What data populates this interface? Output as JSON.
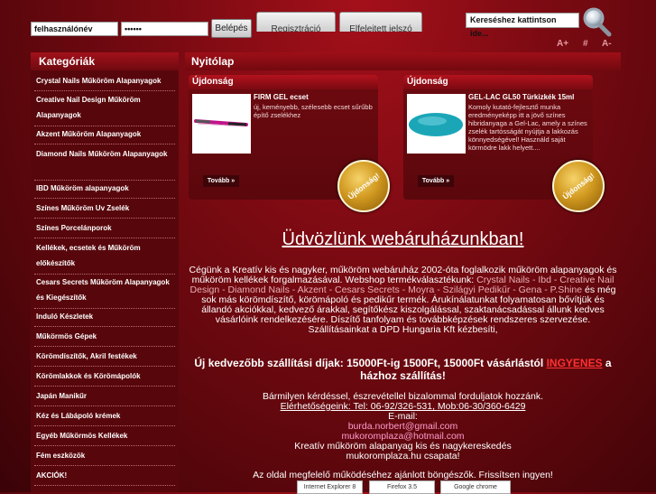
{
  "login": {
    "username_value": "felhasználónév",
    "password_value": "••••••",
    "login_label": "Belépés"
  },
  "tabs": {
    "register_label": "Regisztráció",
    "forgot_label": "Elfelejtett jelszó"
  },
  "search": {
    "value": "Kereséshez kattintson ide..."
  },
  "font_tools": {
    "increase": "A+",
    "reset": "#",
    "decrease": "A-"
  },
  "sidebar": {
    "title": "Kategóriák",
    "items": [
      {
        "label": "Crystal Nails Műköröm Alapanyagok"
      },
      {
        "label": "Creative Nail Design Műköröm Alapanyagok"
      },
      {
        "label": "Akzent Műköröm Alapanyagok"
      },
      {
        "label": "Diamond Nails Műköröm Alapanyagok"
      },
      {
        "label": "IBD Műköröm alapanyagok"
      },
      {
        "label": "Színes Műköröm Uv Zselék"
      },
      {
        "label": "Színes Porcelánporok"
      },
      {
        "label": "Kellékek, ecsetek és Műköröm előkészítők"
      },
      {
        "label": "Cesars Secrets Műköröm Alapanyagok és Kiegészítők"
      },
      {
        "label": "Induló Készletek"
      },
      {
        "label": "Műkörmös Gépek"
      },
      {
        "label": "Körömdíszítők, Akril festékek"
      },
      {
        "label": "Körömlakkok és Körömápolók"
      },
      {
        "label": "Japán Manikűr"
      },
      {
        "label": "Kéz és Lábápoló krémek"
      },
      {
        "label": "Egyéb Műkörmös Kellékek"
      },
      {
        "label": "Fém eszközök"
      },
      {
        "label": "AKCIÓK!"
      }
    ]
  },
  "main": {
    "title": "Nyitólap",
    "cards": [
      {
        "head": "Újdonság",
        "name": "FIRM GEL ecset",
        "desc": "új, keményebb, szélesebb ecset sűrűbb építő zselékhez",
        "more": "Tovább »",
        "badge": "Újdonság!"
      },
      {
        "head": "Újdonság",
        "name": "GEL-LAC GL50 Türkizkék 15ml",
        "desc": "Komoly kutató-fejlesztő munka eredményeképp itt a jövő színes hibridanyaga a Gel-Lac, amely a színes zselék tartósságát nyújtja a lakkozás könnyedségével! Használd saját körmödre lakk helyett....",
        "more": "Tovább »",
        "badge": "Újdonság!"
      }
    ],
    "welcome": "Üdvözlünk webáruházunkban!",
    "intro_1": "Cégünk a Kreatív kis és nagyker, műköröm webáruház 2002-óta foglalkozik műköröm alapanyagok és műköröm kellékek forgalmazásával. Webshop termékválasztékunk:",
    "brands_1": "Crystal Nails - Ibd - Creative Nail Design - Diamond Nails - Akzent - Cesars Secrets - Moyra - Szilágyi Pedikűr - Gena - P.Shine",
    "intro_2": "és még sok más körömdíszítő, körömápoló és pedikűr termék. Árukínálatunkat folyamatosan bővítjük és állandó akciókkal, kedvező árakkal, segítőkész kiszolgálással, szaktanácsadással állunk kedves vásárlóink rendelkezésére. Díszítő tanfolyam és továbbképzések rendszeres szervezése.",
    "delivery": "Szállításainkat a DPD Hungaria Kft kézbesíti,",
    "ship_text": "Új kedvezőbb szállítási díjak: 15000Ft-ig 1500Ft, 15000Ft vásárlástól",
    "ship_free": "INGYENES",
    "ship_end": "a házhoz szállítás!",
    "contact_1": "Bármilyen kérdéssel, észrevétellel bizalommal forduljatok hozzánk.",
    "contact_2": "Elérhetőségeink: Tel: 06-92/326-531, Mob:06-30/360-6429",
    "email_label": "E-mail:",
    "email_1": "burda.norbert@gmail.com",
    "email_2": "mukoromplaza@hotmail.com",
    "footer_1": "Kreatív műköröm alapanyag kis és nagykereskedés",
    "footer_2": "mukoromplaza.hu csapata!",
    "browser_note": "Az oldal megfelelő működéséhez ajánlott böngészők. Frissítsen ingyen!",
    "browsers": [
      "Internet Explorer 8",
      "Firefox 3.5",
      "Google chrome"
    ]
  }
}
